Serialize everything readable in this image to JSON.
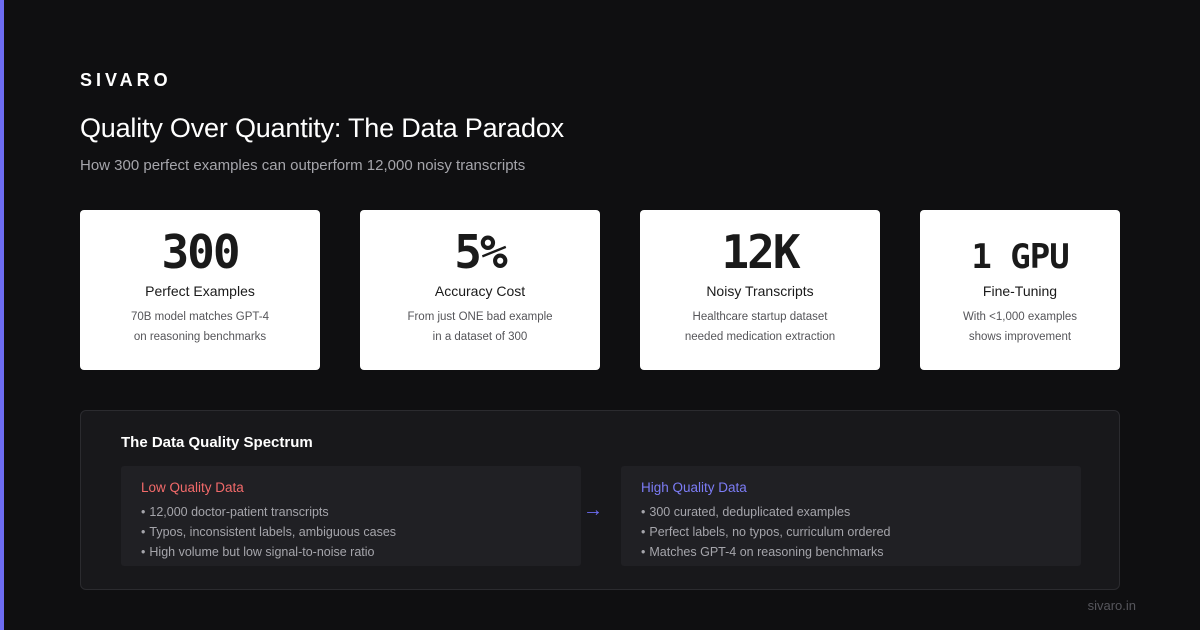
{
  "brand": "SIVARO",
  "title": "Quality Over Quantity: The Data Paradox",
  "subtitle": "How 300 perfect examples can outperform 12,000 noisy transcripts",
  "cards": [
    {
      "value": "300",
      "label": "Perfect Examples",
      "desc_line1": "70B model matches GPT-4",
      "desc_line2": "on reasoning benchmarks"
    },
    {
      "value": "5%",
      "label": "Accuracy Cost",
      "desc_line1": "From just ONE bad example",
      "desc_line2": "in a dataset of 300"
    },
    {
      "value": "12K",
      "label": "Noisy Transcripts",
      "desc_line1": "Healthcare startup dataset",
      "desc_line2": "needed medication extraction"
    },
    {
      "value": "1 GPU",
      "label": "Fine-Tuning",
      "desc_line1": "With <1,000 examples",
      "desc_line2": "shows improvement"
    }
  ],
  "spectrum": {
    "title": "The Data Quality Spectrum",
    "bullet": "•",
    "arrow": "→",
    "low": {
      "heading": "Low Quality Data",
      "items": [
        "12,000 doctor-patient transcripts",
        "Typos, inconsistent labels, ambiguous cases",
        "High volume but low signal-to-noise ratio"
      ]
    },
    "high": {
      "heading": "High Quality Data",
      "items": [
        "300 curated, deduplicated examples",
        "Perfect labels, no typos, curriculum ordered",
        "Matches GPT-4 on reasoning benchmarks"
      ]
    }
  },
  "footer": "sivaro.in",
  "colors": {
    "background": "#0f0f11",
    "accent": "#6d6cf2",
    "low_quality": "#f26a6a",
    "high_quality": "#7c7cf5",
    "card_background": "#ffffff"
  }
}
